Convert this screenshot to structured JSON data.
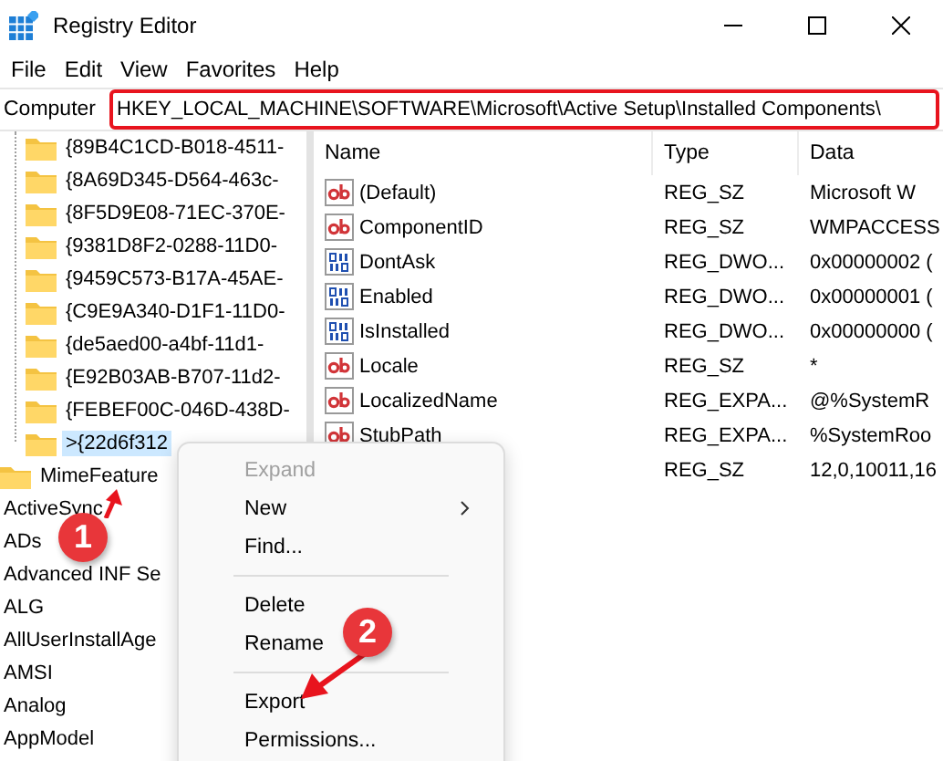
{
  "window": {
    "title": "Registry Editor"
  },
  "menu": [
    "File",
    "Edit",
    "View",
    "Favorites",
    "Help"
  ],
  "address": {
    "label": "Computer",
    "path": "HKEY_LOCAL_MACHINE\\SOFTWARE\\Microsoft\\Active Setup\\Installed Components\\"
  },
  "tree": {
    "items": [
      {
        "children": [
          {
            "label": "{89B4C1CD-B018-4511-",
            "selected": false
          },
          {
            "label": "{8A69D345-D564-463c-",
            "selected": false
          },
          {
            "label": "{8F5D9E08-71EC-370E-",
            "selected": false
          },
          {
            "label": "{9381D8F2-0288-11D0-",
            "selected": false
          },
          {
            "label": "{9459C573-B17A-45AE-",
            "selected": false
          },
          {
            "label": "{C9E9A340-D1F1-11D0-",
            "selected": false
          },
          {
            "label": "{de5aed00-a4bf-11d1-",
            "selected": false
          },
          {
            "label": "{E92B03AB-B707-11d2-",
            "selected": false
          },
          {
            "label": "{FEBEF00C-046D-438D-",
            "selected": false
          },
          {
            "label": ">{22d6f312",
            "selected": true
          }
        ]
      },
      {
        "label": "MimeFeature",
        "kind": "folder",
        "selected": false
      },
      {
        "label": "ActiveSync",
        "kind": "plain",
        "selected": false
      },
      {
        "label": "ADs",
        "kind": "plain",
        "selected": false
      },
      {
        "label": "Advanced INF Se",
        "kind": "plain",
        "selected": false
      },
      {
        "label": "ALG",
        "kind": "plain",
        "selected": false
      },
      {
        "label": "AllUserInstallAge",
        "kind": "plain",
        "selected": false
      },
      {
        "label": "AMSI",
        "kind": "plain",
        "selected": false
      },
      {
        "label": "Analog",
        "kind": "plain",
        "selected": false
      },
      {
        "label": "AppModel",
        "kind": "plain",
        "selected": false
      }
    ]
  },
  "values": {
    "columns": [
      "Name",
      "Type",
      "Data"
    ],
    "rows": [
      {
        "kind": "string",
        "name": "(Default)",
        "type": "REG_SZ",
        "data": "Microsoft W"
      },
      {
        "kind": "string",
        "name": "ComponentID",
        "type": "REG_SZ",
        "data": "WMPACCESS"
      },
      {
        "kind": "binary",
        "name": "DontAsk",
        "type": "REG_DWO...",
        "data": "0x00000002 ("
      },
      {
        "kind": "binary",
        "name": "Enabled",
        "type": "REG_DWO...",
        "data": "0x00000001 ("
      },
      {
        "kind": "binary",
        "name": "IsInstalled",
        "type": "REG_DWO...",
        "data": "0x00000000 ("
      },
      {
        "kind": "string",
        "name": "Locale",
        "type": "REG_SZ",
        "data": "*"
      },
      {
        "kind": "string",
        "name": "LocalizedName",
        "type": "REG_EXPA...",
        "data": "@%SystemR"
      },
      {
        "kind": "string",
        "name": "StubPath",
        "type": "REG_EXPA...",
        "data": "%SystemRoo"
      },
      {
        "kind": "none",
        "type": "REG_SZ",
        "data": "12,0,10011,16"
      }
    ]
  },
  "context_menu": [
    {
      "kind": "item",
      "label": "Expand",
      "disabled": true,
      "submenu": false
    },
    {
      "kind": "item",
      "label": "New",
      "disabled": false,
      "submenu": true
    },
    {
      "kind": "item",
      "label": "Find...",
      "disabled": false,
      "submenu": false
    },
    {
      "kind": "separator"
    },
    {
      "kind": "item",
      "label": "Delete",
      "disabled": false,
      "submenu": false
    },
    {
      "kind": "item",
      "label": "Rename",
      "disabled": false,
      "submenu": false
    },
    {
      "kind": "separator"
    },
    {
      "kind": "item",
      "label": "Export",
      "disabled": false,
      "submenu": false
    },
    {
      "kind": "item",
      "label": "Permissions...",
      "disabled": false,
      "submenu": false
    }
  ],
  "callouts": [
    "1",
    "2"
  ]
}
